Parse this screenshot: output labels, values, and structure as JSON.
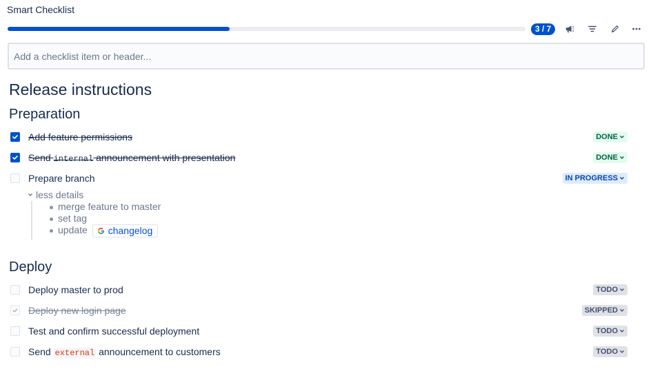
{
  "app": {
    "title": "Smart Checklist"
  },
  "progress": {
    "done": 3,
    "total": 7,
    "label": "3 / 7"
  },
  "toolbar": {
    "icons": [
      "megaphone-icon",
      "filter-icon",
      "pencil-icon",
      "more-icon"
    ]
  },
  "add_input": {
    "placeholder": "Add a checklist item or header..."
  },
  "checklist": {
    "title": "Release instructions",
    "sections": [
      {
        "header": "Preparation",
        "items": [
          {
            "text": "Add feature permissions",
            "checked": true,
            "status": "DONE"
          },
          {
            "text_before": "Send ",
            "code": "internal",
            "text_after": " announcement with presentation",
            "checked": true,
            "status": "DONE"
          },
          {
            "text": "Prepare branch",
            "checked": false,
            "status": "IN PROGRESS",
            "details": {
              "toggle_label": "less details",
              "lines": [
                "merge feature to master",
                "set tag"
              ],
              "link_line": {
                "prefix": "update",
                "link_text": "changelog",
                "link_icon": "google-icon"
              }
            }
          }
        ]
      },
      {
        "header": "Deploy",
        "items": [
          {
            "text": "Deploy master to prod",
            "checked": false,
            "status": "TODO"
          },
          {
            "text": "Deploy new login page",
            "checked": false,
            "skipped": true,
            "status": "SKIPPED"
          },
          {
            "text": "Test and confirm successful deployment",
            "checked": false,
            "status": "TODO"
          },
          {
            "text_before": "Send ",
            "code": "external",
            "text_after": " announcement to customers",
            "checked": false,
            "status": "TODO"
          }
        ]
      }
    ]
  },
  "colors": {
    "accent": "#0052cc",
    "done_bg": "#e3fcef",
    "done_fg": "#006644",
    "progress_bg": "#deebff",
    "progress_fg": "#0747a6",
    "todo_bg": "#dfe1e6",
    "todo_fg": "#42526e",
    "code_red": "#de350b"
  }
}
